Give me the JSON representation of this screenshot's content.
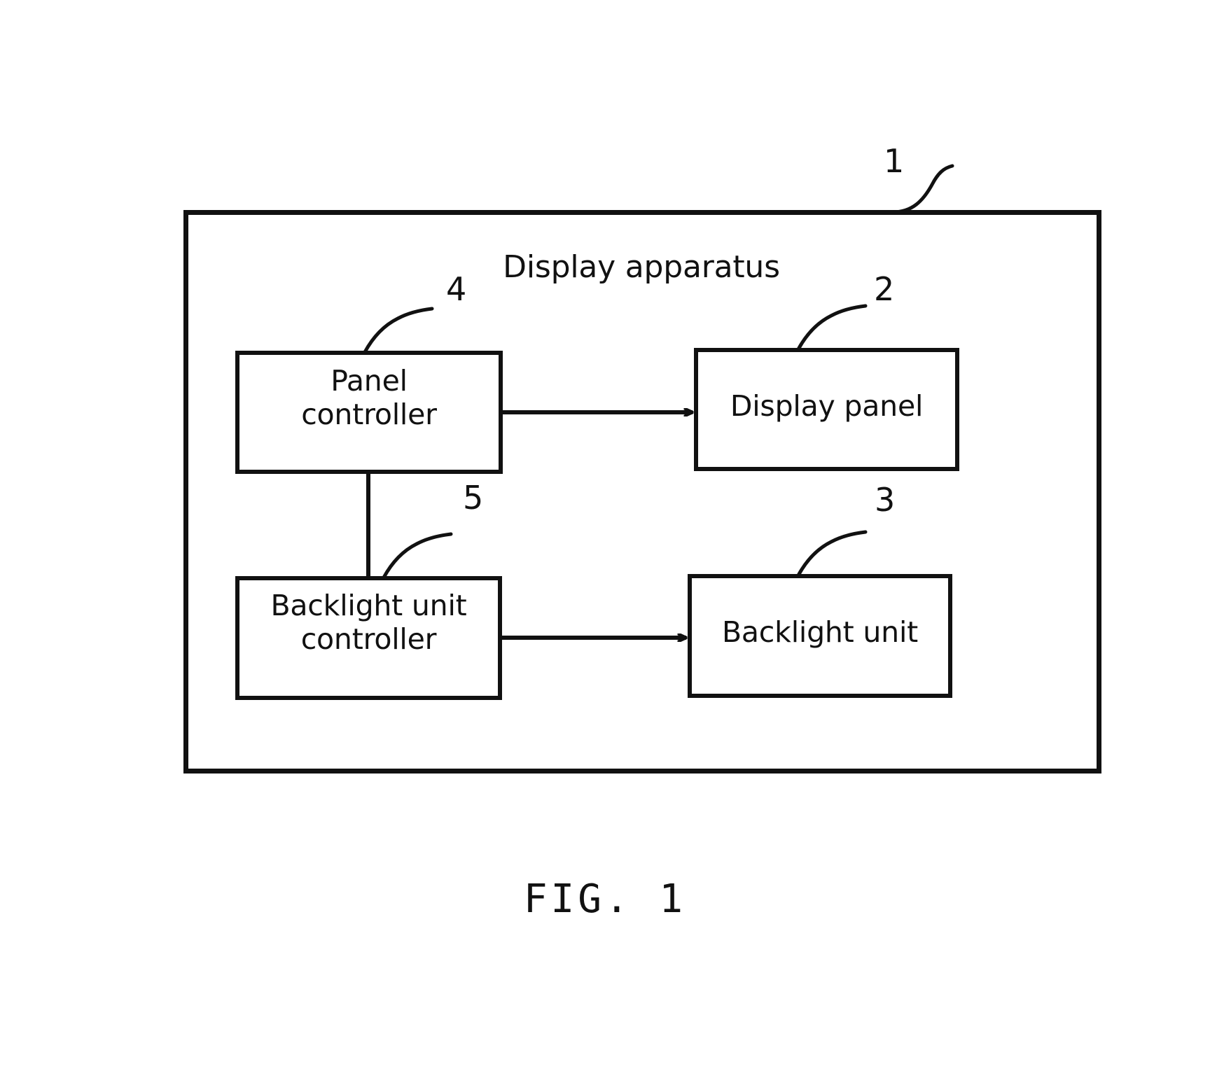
{
  "figure": {
    "caption": "FIG. 1",
    "title": "Display apparatus",
    "outer_block": {
      "label": "Display apparatus",
      "ref": "1"
    },
    "blocks": [
      {
        "id": "panel-controller",
        "label": "Panel\ncontroller",
        "ref": "4"
      },
      {
        "id": "display-panel",
        "label": "Display panel",
        "ref": "2"
      },
      {
        "id": "bl-unit-controller",
        "label": "Backlight unit\ncontroller",
        "ref": "5"
      },
      {
        "id": "backlight-unit",
        "label": "Backlight unit",
        "ref": "3"
      }
    ],
    "connections": [
      {
        "from": "panel-controller",
        "to": "display-panel",
        "kind": "arrow"
      },
      {
        "from": "bl-unit-controller",
        "to": "backlight-unit",
        "kind": "arrow"
      },
      {
        "from": "panel-controller",
        "to": "bl-unit-controller",
        "kind": "line"
      }
    ],
    "colors": {
      "stroke": "#111111",
      "background": "#ffffff"
    }
  }
}
